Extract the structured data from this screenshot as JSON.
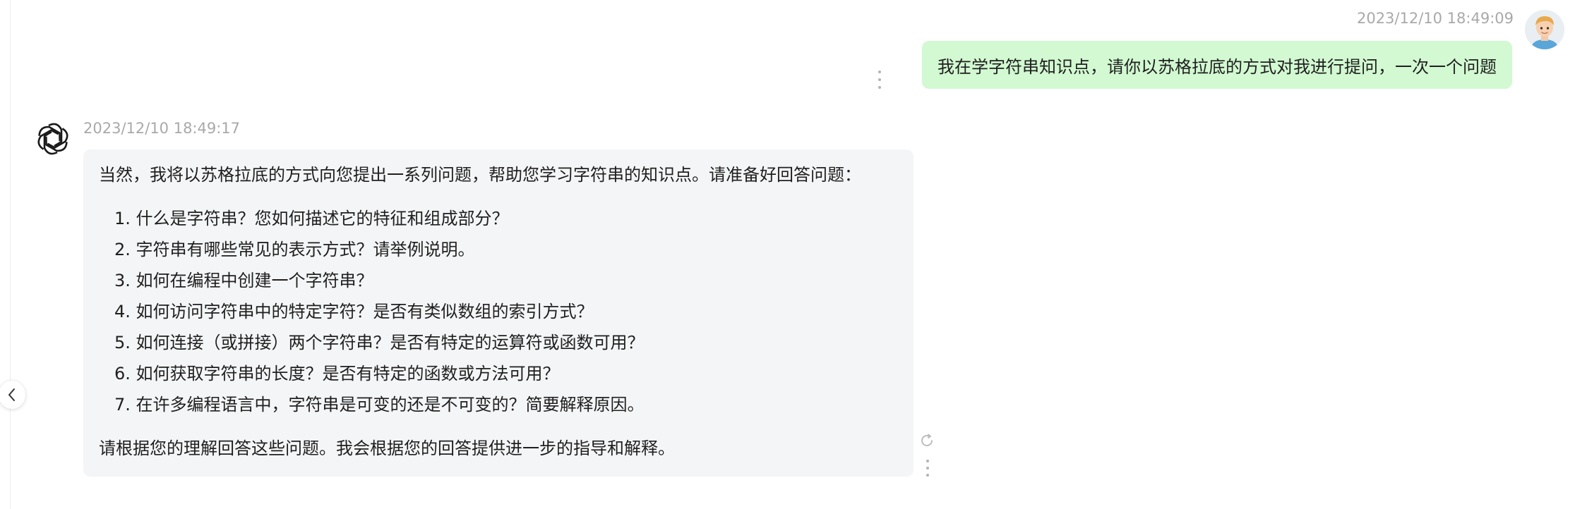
{
  "user_message": {
    "timestamp": "2023/12/10 18:49:09",
    "text": "我在学字符串知识点，请你以苏格拉底的方式对我进行提问，一次一个问题"
  },
  "assistant_message": {
    "timestamp": "2023/12/10 18:49:17",
    "intro": "当然，我将以苏格拉底的方式向您提出一系列问题，帮助您学习字符串的知识点。请准备好回答问题：",
    "questions": [
      "1. 什么是字符串？您如何描述它的特征和组成部分？",
      "2. 字符串有哪些常见的表示方式？请举例说明。",
      "3. 如何在编程中创建一个字符串？",
      "4. 如何访问字符串中的特定字符？是否有类似数组的索引方式？",
      "5. 如何连接（或拼接）两个字符串？是否有特定的运算符或函数可用？",
      "6. 如何获取字符串的长度？是否有特定的函数或方法可用？",
      "7. 在许多编程语言中，字符串是可变的还是不可变的？简要解释原因。"
    ],
    "outro": "请根据您的理解回答这些问题。我会根据您的回答提供进一步的指导和解释。"
  },
  "icons": {
    "collapse": "chevron-left-icon",
    "more": "more-vertical-icon",
    "regenerate": "refresh-icon",
    "assistant_avatar": "openai-logo-icon",
    "user_avatar": "user-avatar-icon"
  },
  "colors": {
    "user_bubble": "#d2f9d1",
    "assistant_bubble": "#f4f5f7",
    "timestamp": "#a9a9a9"
  }
}
